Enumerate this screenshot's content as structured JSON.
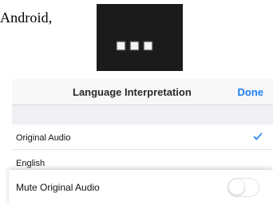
{
  "document": {
    "text": "Android,"
  },
  "more_button": {
    "icon": "more-dots-icon"
  },
  "panel": {
    "title": "Language Interpretation",
    "done_label": "Done",
    "options": [
      {
        "label": "Original Audio",
        "selected": true
      },
      {
        "label": "English",
        "selected": false
      }
    ]
  },
  "mute": {
    "label": "Mute Original Audio",
    "enabled": false
  },
  "colors": {
    "accent": "#1a7ff2",
    "button_bg": "#1b1b1b",
    "panel_bg": "#efeff4"
  }
}
